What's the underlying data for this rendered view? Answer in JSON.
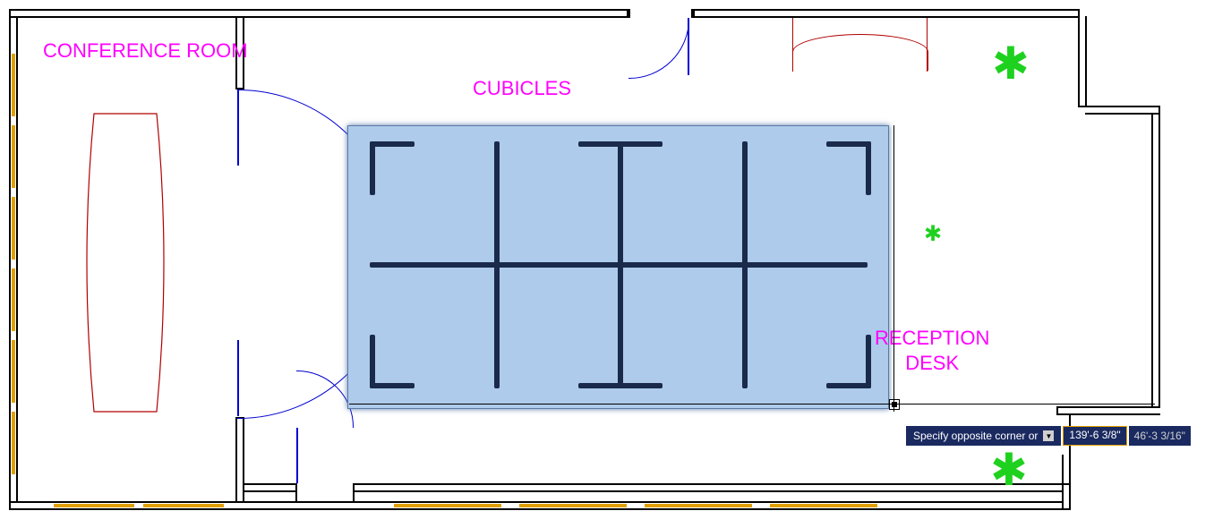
{
  "labels": {
    "conference": "CONFERENCE ROOM",
    "cubicles": "CUBICLES",
    "reception": "RECEPTION\nDESK"
  },
  "prompt": {
    "text": "Specify opposite corner or",
    "input_value": "139'-6 3/8\"",
    "coord": "46'-3 3/16\""
  },
  "icons": {
    "plant": "✱",
    "dropdown": "▼"
  }
}
